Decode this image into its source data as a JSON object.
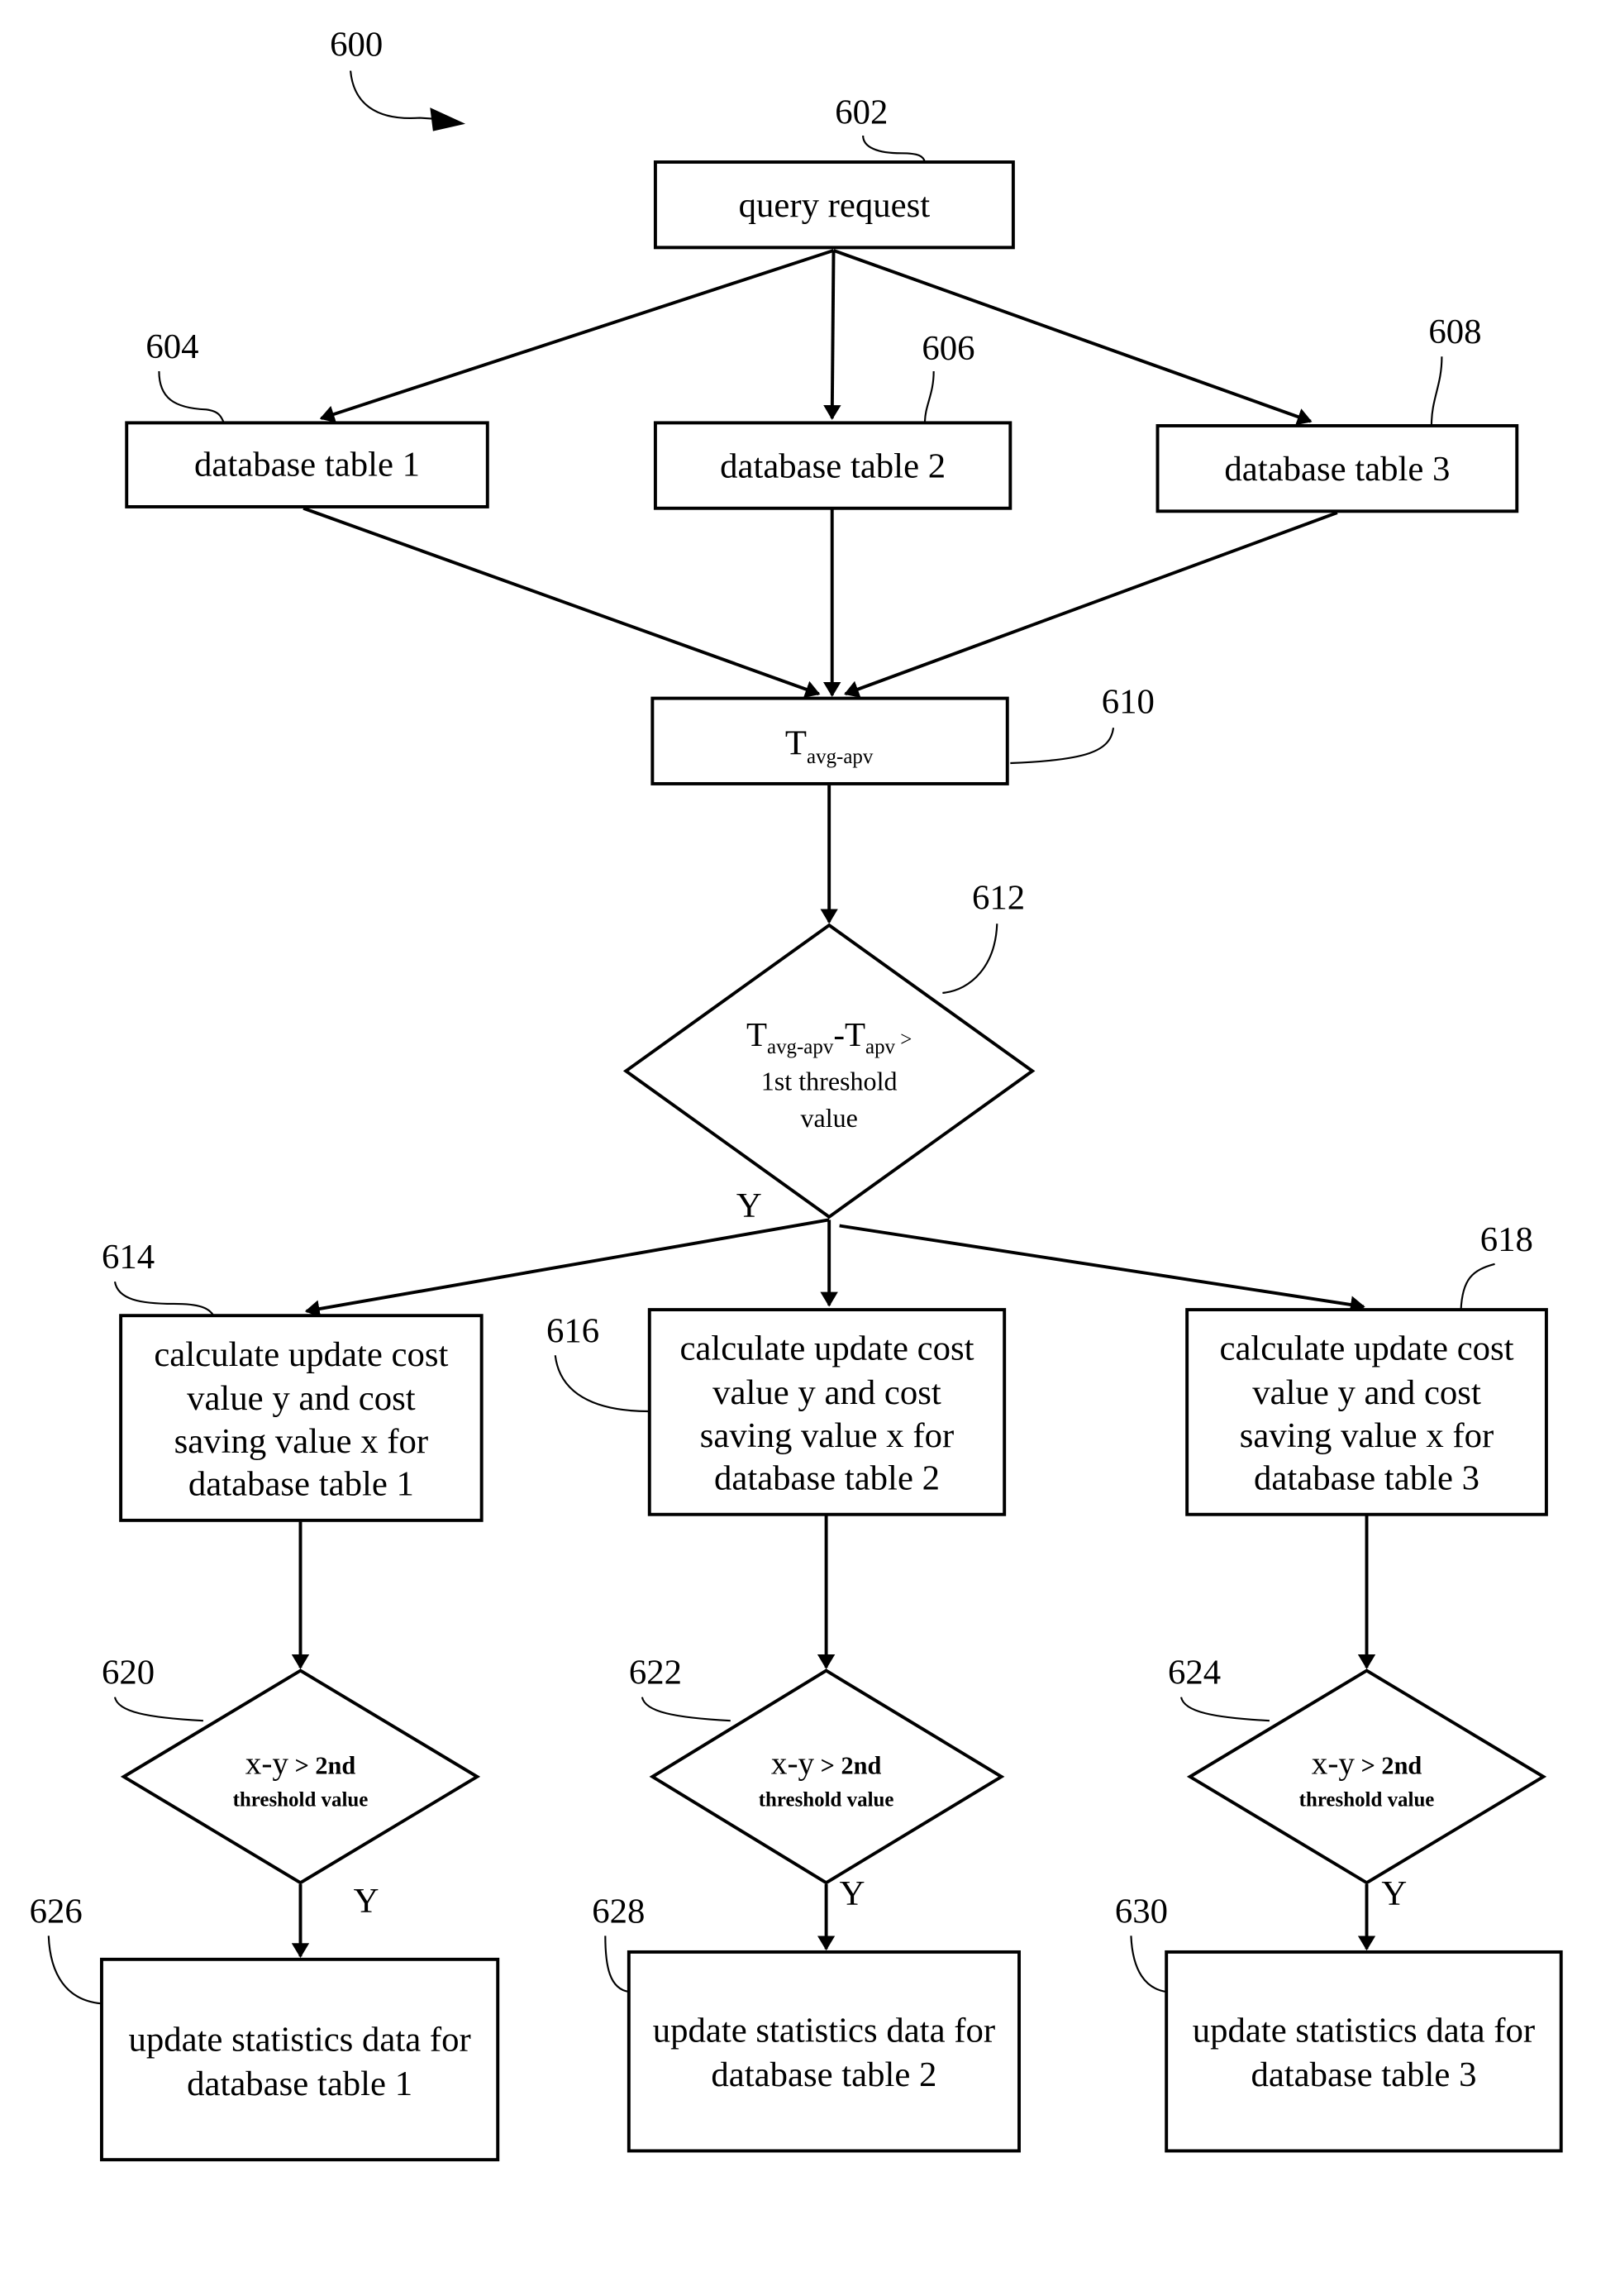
{
  "figure": {
    "ref": "600"
  },
  "nodes": {
    "query": {
      "ref": "602",
      "text": "query request"
    },
    "db1": {
      "ref": "604",
      "text": "database table 1"
    },
    "db2": {
      "ref": "606",
      "text": "database table 2"
    },
    "db3": {
      "ref": "608",
      "text": "database table 3"
    },
    "tavg": {
      "ref": "610",
      "main": "T",
      "sub": "avg-apv"
    },
    "decision1": {
      "ref": "612",
      "line1_main1": "T",
      "line1_sub1": "avg-apv",
      "line1_dash": "-",
      "line1_main2": "T",
      "line1_sub2": "apv",
      "line1_op": " >",
      "line2": "1st threshold",
      "line3": "value",
      "yes_label": "Y"
    },
    "calc1": {
      "ref": "614",
      "lines": [
        "calculate update cost",
        "value y and cost",
        "saving value x for",
        "database table 1"
      ]
    },
    "calc2": {
      "ref": "616",
      "lines": [
        "calculate update cost",
        "value y and cost",
        "saving value x for",
        "database table 2"
      ]
    },
    "calc3": {
      "ref": "618",
      "lines": [
        "calculate update cost",
        "value y and cost",
        "saving value x for",
        "database table 3"
      ]
    },
    "dec2": {
      "ref": "620",
      "line1_expr": "x-y",
      "line1_rest": " > 2nd",
      "line2": "threshold value",
      "yes_label": "Y"
    },
    "dec3": {
      "ref": "622",
      "line1_expr": "x-y",
      "line1_rest": " > 2nd",
      "line2": "threshold value",
      "yes_label": "Y"
    },
    "dec4": {
      "ref": "624",
      "line1_expr": "x-y",
      "line1_rest": " > 2nd",
      "line2": "threshold value",
      "yes_label": "Y"
    },
    "upd1": {
      "ref": "626",
      "lines": [
        "update statistics data for",
        "database table 1"
      ]
    },
    "upd2": {
      "ref": "628",
      "lines": [
        "update statistics data for",
        "database table 2"
      ]
    },
    "upd3": {
      "ref": "630",
      "lines": [
        "update statistics data for",
        "database table 3"
      ]
    }
  }
}
